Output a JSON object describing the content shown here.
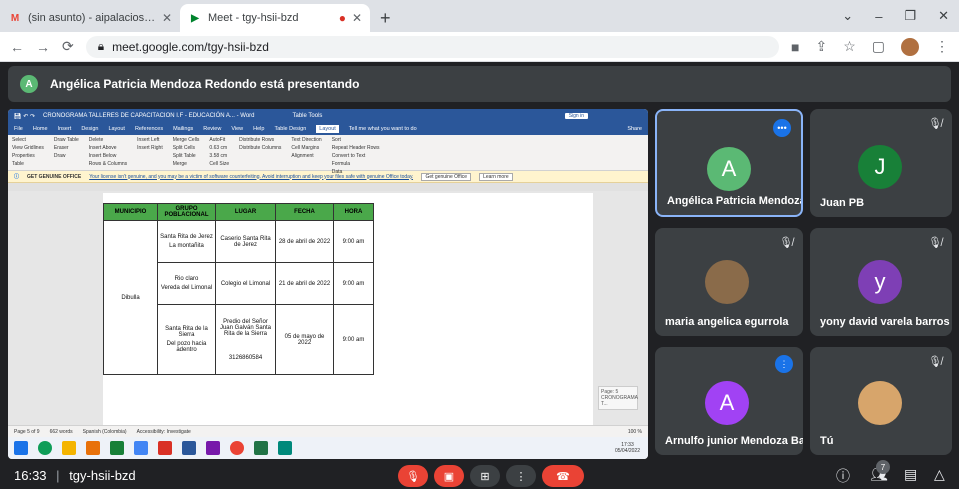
{
  "browser": {
    "tabs": [
      {
        "title": "(sin asunto) - aipalaciosd@ufpsc",
        "favicon": "M",
        "favicon_color": "#ea4335"
      },
      {
        "title": "Meet - tgy-hsii-bzd",
        "favicon": "▶",
        "favicon_color": "#00832d"
      }
    ],
    "new_tab": "+",
    "url": "meet.google.com/tgy-hsii-bzd",
    "window_controls": [
      "⌄",
      "–",
      "❐",
      "✕"
    ]
  },
  "meet": {
    "presenting_banner": "Angélica Patricia Mendoza Redondo está presentando",
    "presenter_initial": "A",
    "time": "16:33",
    "meeting_code": "tgy-hsii-bzd",
    "participants_count": "7",
    "tiles": [
      {
        "name": "Angélica Patricia Mendoza...",
        "initial": "A",
        "color": "#5bb974"
      },
      {
        "name": "Juan PB",
        "initial": "J",
        "color": "#188038"
      },
      {
        "name": "maria angelica egurrola",
        "initial": "",
        "color": "#8a6b4a"
      },
      {
        "name": "yony david varela barros",
        "initial": "y",
        "color": "#7e3fb5"
      },
      {
        "name": "Arnulfo junior Mendoza Ba...",
        "initial": "A",
        "color": "#a142f4"
      },
      {
        "name": "Tú",
        "initial": "",
        "color": "#d7a56b"
      }
    ]
  },
  "word": {
    "title": "CRONOGRAMA TALLERES DE CAPACITACION I.F - EDUCACIÓN A... - Word",
    "table_tools": "Table Tools",
    "sign_in": "Sign in",
    "menu": [
      "File",
      "Home",
      "Insert",
      "Design",
      "Layout",
      "References",
      "Mailings",
      "Review",
      "View",
      "Help",
      "Table Design",
      "Layout",
      "Tell me what you want to do",
      "Share"
    ],
    "ribbon": {
      "table_group": [
        "Select",
        "View Gridlines",
        "Properties",
        "Table"
      ],
      "draw_group": [
        "Draw Table",
        "Eraser",
        "Draw"
      ],
      "rows_cols": [
        "Delete",
        "Insert Above",
        "Insert Below",
        "Insert Left",
        "Insert Right",
        "Rows & Columns"
      ],
      "merge": [
        "Merge Cells",
        "Split Cells",
        "Split Table",
        "Merge"
      ],
      "cell_size": [
        "AutoFit",
        "0.63 cm",
        "3.58 cm",
        "Distribute Rows",
        "Distribute Columns",
        "Cell Size"
      ],
      "alignment": [
        "Text Direction",
        "Cell Margins",
        "Alignment"
      ],
      "data": [
        "Sort",
        "Repeat Header Rows",
        "Convert to Text",
        "Formula",
        "Data"
      ]
    },
    "warning": {
      "label": "GET GENUINE OFFICE",
      "text": "Your license isn't genuine, and you may be a victim of software counterfeiting. Avoid interruption and keep your files safe with genuine Office today.",
      "btn1": "Get genuine Office",
      "btn2": "Learn more"
    },
    "status": [
      "Page 5 of 9",
      "662 words",
      "Spanish (Colombia)",
      "Accessibility: Investigate"
    ],
    "zoom": "100 %",
    "page_label": "Page: 5 CRONOGRAMA T...",
    "taskbar_time": "17:33",
    "taskbar_date": "05/04/2022"
  },
  "schedule": {
    "headers": [
      "MUNICIPIO",
      "GRUPO POBLACIONAL",
      "LUGAR",
      "FECHA",
      "HORA"
    ],
    "municipio": "Dibulla",
    "rows": [
      {
        "grupo": [
          "Santa Rita de Jerez",
          "La montañita"
        ],
        "lugar": "Caserio Santa Rita de Jerez",
        "fecha": "28 de abril de 2022",
        "hora": "9:00 am"
      },
      {
        "grupo": [
          "Rio claro",
          "Vereda del Limonal"
        ],
        "lugar": "Colegio el Limonal",
        "fecha": "21 de abril de 2022",
        "hora": "9:00 am"
      },
      {
        "grupo": [
          "Santa Rita de la Sierra",
          "Del pozo hacia adentro"
        ],
        "lugar": "Predio del Señor Juan Galván Santa Rita de la Sierra",
        "lugar2": "3126860584",
        "fecha": "05 de mayo de 2022",
        "hora": "9:00 am"
      }
    ]
  }
}
